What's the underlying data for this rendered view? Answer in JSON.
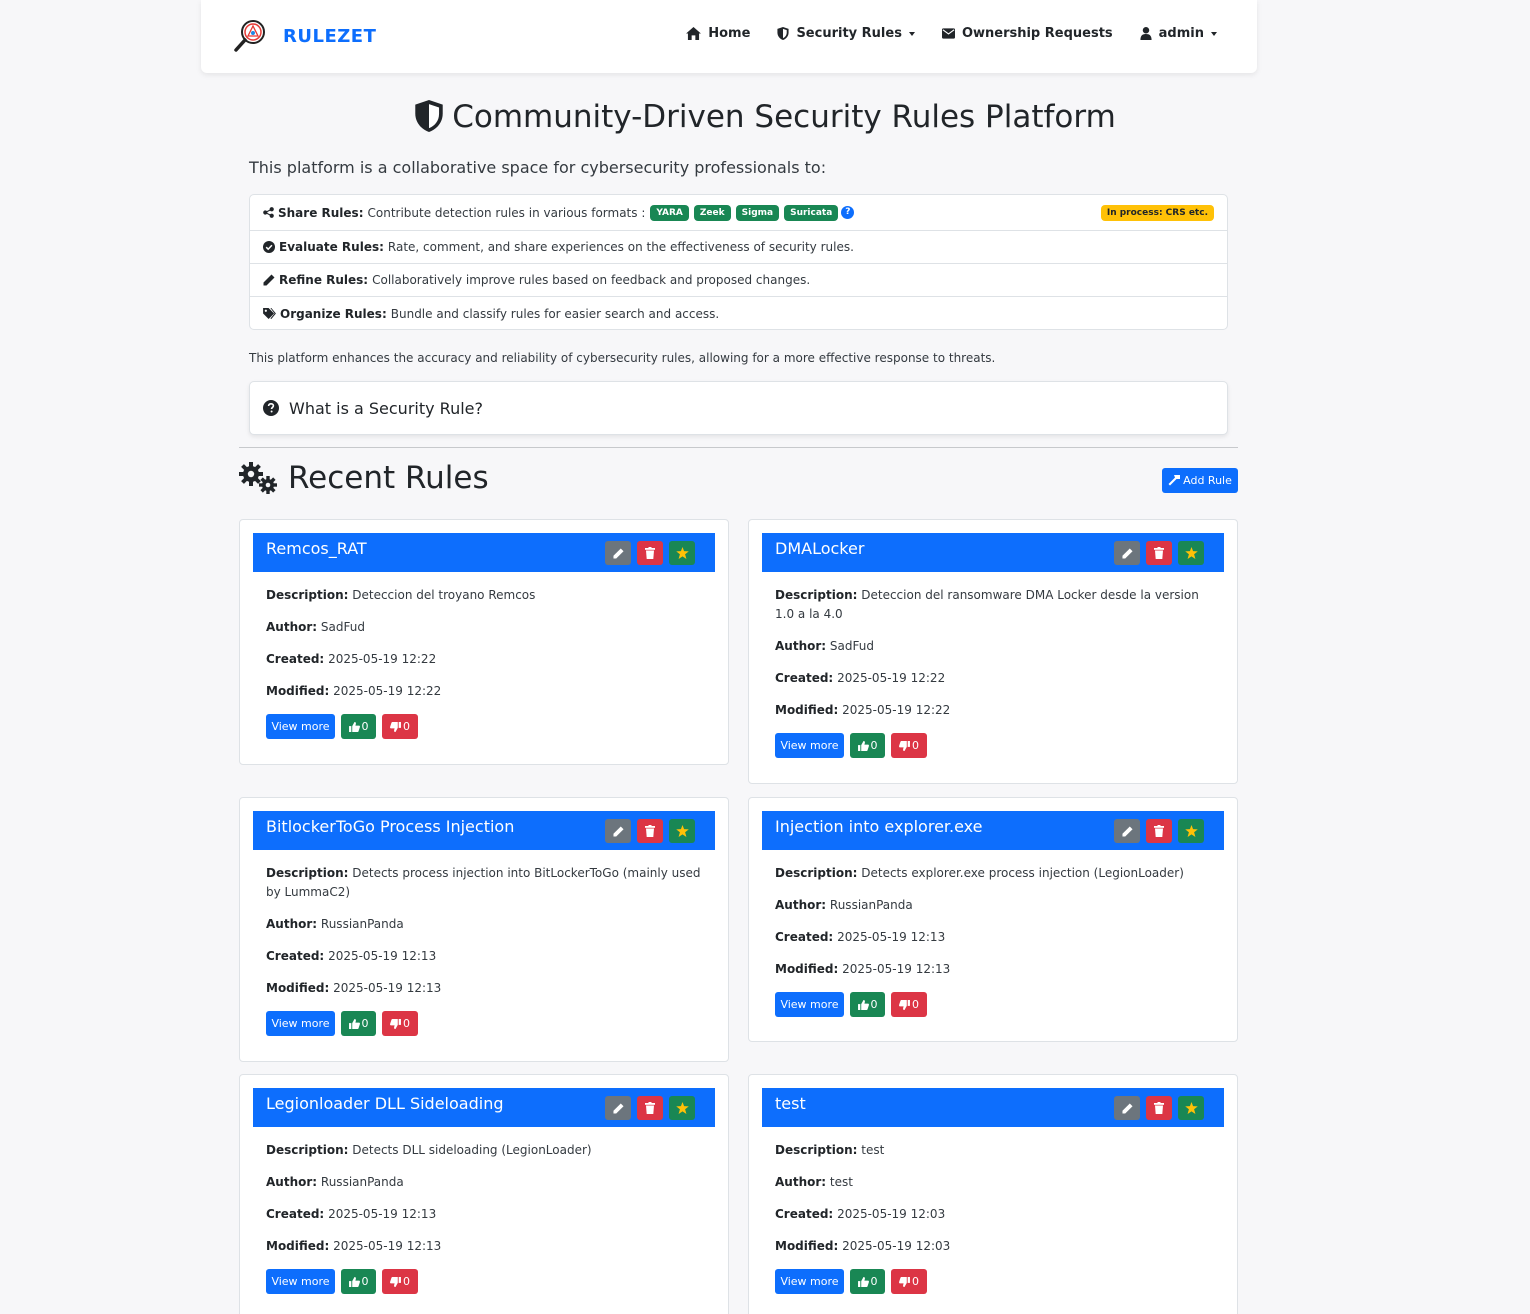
{
  "navbar": {
    "brand": "RULEZET",
    "items": [
      {
        "label": "Home",
        "icon": "home-icon"
      },
      {
        "label": "Security Rules",
        "icon": "shield-icon",
        "dropdown": true
      },
      {
        "label": "Ownership Requests",
        "icon": "envelope-icon"
      },
      {
        "label": "admin",
        "icon": "user-icon",
        "dropdown": true
      }
    ]
  },
  "hero": {
    "title": "Community-Driven Security Rules Platform",
    "intro": "This platform is a collaborative space for cybersecurity professionals to:"
  },
  "features": {
    "share": {
      "label": "Share Rules:",
      "text": "Contribute detection rules in various formats :",
      "formats": [
        "YARA",
        "Zeek",
        "Sigma",
        "Suricata"
      ],
      "help": "?",
      "in_process": "In process: CRS etc."
    },
    "evaluate": {
      "label": "Evaluate Rules:",
      "text": "Rate, comment, and share experiences on the effectiveness of security rules."
    },
    "refine": {
      "label": "Refine Rules:",
      "text": "Collaboratively improve rules based on feedback and proposed changes."
    },
    "organize": {
      "label": "Organize Rules:",
      "text": "Bundle and classify rules for easier search and access."
    }
  },
  "enhance_text": "This platform enhances the accuracy and reliability of cybersecurity rules, allowing for a more effective response to threats.",
  "accordion": {
    "label": "What is a Security Rule?"
  },
  "recent": {
    "title": "Recent Rules",
    "add_label": "Add Rule"
  },
  "labels": {
    "description": "Description:",
    "author": "Author:",
    "created": "Created:",
    "modified": "Modified:",
    "view_more": "View more"
  },
  "rules": [
    {
      "title": "Remcos_RAT",
      "description": "Deteccion del troyano Remcos",
      "author": "SadFud",
      "created": "2025-05-19 12:22",
      "modified": "2025-05-19 12:22",
      "up": "0",
      "down": "0"
    },
    {
      "title": "DMALocker",
      "description": "Deteccion del ransomware DMA Locker desde la version 1.0 a la 4.0",
      "author": "SadFud",
      "created": "2025-05-19 12:22",
      "modified": "2025-05-19 12:22",
      "up": "0",
      "down": "0"
    },
    {
      "title": "BitlockerToGo Process Injection",
      "description": "Detects process injection into BitLockerToGo (mainly used by LummaC2)",
      "author": "RussianPanda",
      "created": "2025-05-19 12:13",
      "modified": "2025-05-19 12:13",
      "up": "0",
      "down": "0"
    },
    {
      "title": "Injection into explorer.exe",
      "description": "Detects explorer.exe process injection (LegionLoader)",
      "author": "RussianPanda",
      "created": "2025-05-19 12:13",
      "modified": "2025-05-19 12:13",
      "up": "0",
      "down": "0"
    },
    {
      "title": "Legionloader DLL Sideloading",
      "description": "Detects DLL sideloading (LegionLoader)",
      "author": "RussianPanda",
      "created": "2025-05-19 12:13",
      "modified": "2025-05-19 12:13",
      "up": "0",
      "down": "0"
    },
    {
      "title": "test",
      "description": "test",
      "author": "test",
      "created": "2025-05-19 12:03",
      "modified": "2025-05-19 12:03",
      "up": "0",
      "down": "0"
    }
  ],
  "colors": {
    "primary": "#0d6efd",
    "success": "#198754",
    "danger": "#dc3545",
    "secondary": "#6c757d",
    "warning": "#ffc107"
  }
}
